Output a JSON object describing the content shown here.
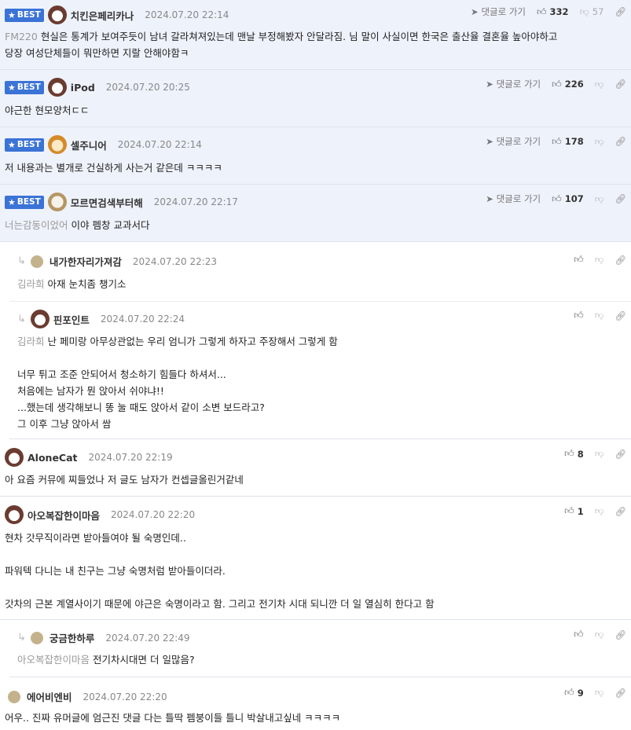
{
  "labels": {
    "best": "BEST",
    "goto": "댓글로 가기"
  },
  "comments": [
    {
      "nick": "치킨은페리카나",
      "date": "2024.07.20 22:14",
      "up": "332",
      "down": "57",
      "quote": "FM220",
      "text": "현실은 통계가 보여주듯이 남녀 갈라쳐져있는데 맨날 부정해봤자 안달라짐. 님 말이 사실이면 한국은 출산율 결혼율 높아야하고\n당장 여성단체들이 뭐만하면 지랄 안해야함ㅋ"
    },
    {
      "nick": "iPod",
      "date": "2024.07.20 20:25",
      "up": "226",
      "text": "야근한 현모양처ㄷㄷ"
    },
    {
      "nick": "셀주니어",
      "date": "2024.07.20 22:14",
      "up": "178",
      "text": "저 내용과는 별개로 건실하게 사는거 같은데 ㅋㅋㅋㅋ"
    },
    {
      "nick": "모르면검색부터해",
      "date": "2024.07.20 22:17",
      "up": "107",
      "quote": "너는감동이었어",
      "text": "이야 펨창 교과서다"
    },
    {
      "nick": "내가한자리가져감",
      "date": "2024.07.20 22:23",
      "quote": "김라희",
      "text": "아재 눈치좀 챙기소"
    },
    {
      "nick": "핀포인트",
      "date": "2024.07.20 22:24",
      "quote": "김라희",
      "text": "난 페미랑 아무상관없는 우리 엄니가 그렇게 하자고 주장해서 그렇게 함\n\n너무 튀고 조준 안되어서 청소하기 힘들다 하셔서...\n처음에는 남자가 뭔 앉아서 쉬야냐!!\n...했는데 생각해보니 똥 눌 때도 앉아서 같이 소변 보드라고?\n그 이후 그냥 앉아서 쌈"
    },
    {
      "nick": "AloneCat",
      "date": "2024.07.20 22:19",
      "up": "8",
      "text": "아 요즘 커뮤에 찌들었나 저 글도 남자가 컨셉글올린거같네"
    },
    {
      "nick": "아오복잡한이마음",
      "date": "2024.07.20 22:20",
      "up": "1",
      "text": "현차 갓무직이라면 받아들여야 될 숙명인데..\n\n파워텍 다니는 내 친구는 그냥 숙명처럼 받아들이더라.\n\n갓차의 근본 계열사이기 때문에 야근은 숙명이라고 함. 그리고 전기차 시대 되니깐 더 일 열심히 한다고 함"
    },
    {
      "nick": "궁금한하루",
      "date": "2024.07.20 22:49",
      "quote": "아오복잡한이마음",
      "text": "전기차시대면 더 일많음?"
    },
    {
      "nick": "에어비엔비",
      "date": "2024.07.20 22:20",
      "up": "9",
      "text": "어우.. 진짜 유머글에 엄근진 댓글 다는 틀딱 펨붕이들 틀니 박살내고싶네 ㅋㅋㅋㅋ"
    }
  ]
}
